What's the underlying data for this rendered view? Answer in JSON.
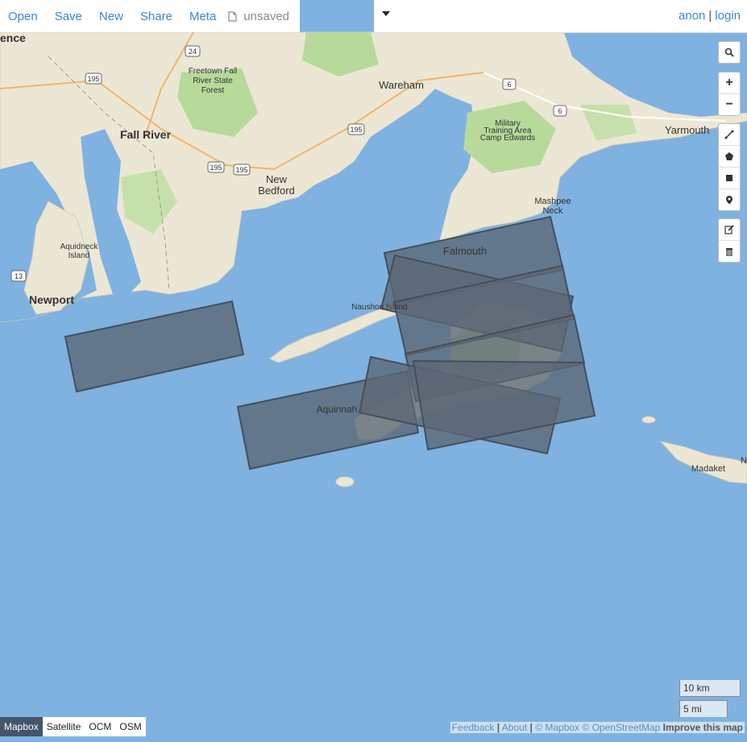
{
  "menu": {
    "open": "Open",
    "save": "Save",
    "new": "New",
    "share": "Share",
    "meta": "Meta",
    "file_status": "unsaved"
  },
  "user": {
    "name": "anon",
    "separator": "|",
    "login": "login"
  },
  "map_labels": {
    "fall_river": "Fall River",
    "freetown": "Freetown Fall River State Forest",
    "freetown_1": "Freetown Fall",
    "freetown_2": "River State",
    "freetown_3": "Forest",
    "wareham": "Wareham",
    "new_bedford_1": "New",
    "new_bedford_2": "Bedford",
    "military_1": "Military",
    "military_2": "Training Area",
    "military_3": "Camp Edwards",
    "yarmouth": "Yarmouth",
    "mashpee_1": "Mashpee",
    "mashpee_2": "Neck",
    "aquidneck_1": "Aquidneck",
    "aquidneck_2": "Island",
    "newport": "Newport",
    "falmouth": "Falmouth",
    "naushon": "Naushon Island",
    "aquinnah": "Aquinnah",
    "madaket": "Madaket",
    "providence_partial": "ence",
    "nantucket_partial": "N",
    "route_24": "24",
    "route_195a": "195",
    "route_195b": "195",
    "route_195c": "195",
    "route_195d": "195",
    "route_6a": "6",
    "route_6b": "6",
    "route_13": "13"
  },
  "map_controls": {
    "search_icon": "search-icon",
    "zoom_in": "+",
    "zoom_out": "−"
  },
  "scale": {
    "km": "10 km",
    "mi": "5 mi"
  },
  "layers": [
    {
      "label": "Mapbox",
      "active": true
    },
    {
      "label": "Satellite",
      "active": false
    },
    {
      "label": "OCM",
      "active": false
    },
    {
      "label": "OSM",
      "active": false
    }
  ],
  "attribution": {
    "feedback": "Feedback",
    "sep1": "|",
    "about": "About",
    "sep2": "|",
    "mapbox": "© Mapbox",
    "osm": "© OpenStreetMap",
    "improve": "Improve this map"
  },
  "colors": {
    "water": "#7fb2e0",
    "land": "#ece7d4",
    "park": "#b7da9a",
    "polygon_fill": "#5b6675",
    "polygon_stroke": "#454e5b",
    "link": "#3a87c8"
  }
}
